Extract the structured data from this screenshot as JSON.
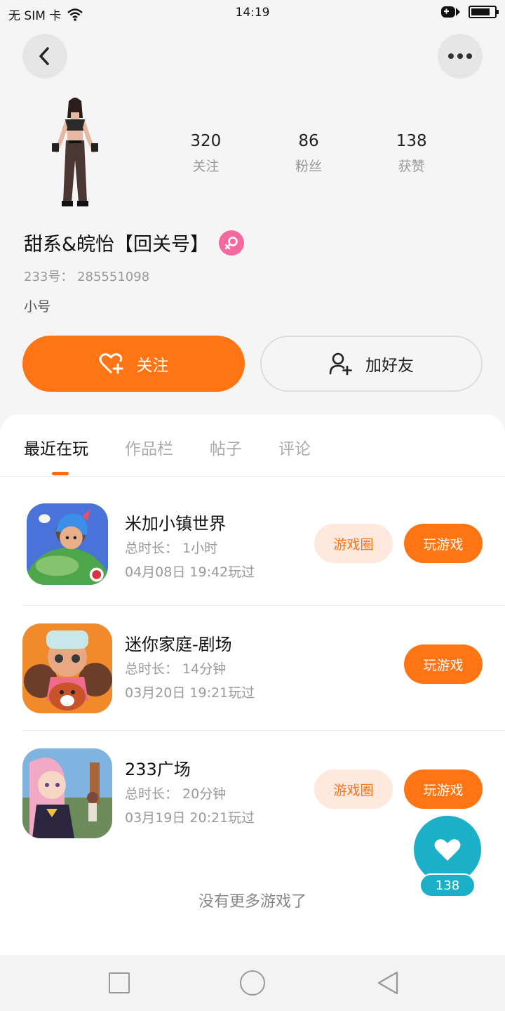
{
  "status_bar": {
    "carrier": "无 SIM 卡",
    "time": "14:19",
    "battery_level": 0.8
  },
  "profile": {
    "stats": [
      {
        "value": "320",
        "label": "关注"
      },
      {
        "value": "86",
        "label": "粉丝"
      },
      {
        "value": "138",
        "label": "获赞"
      }
    ],
    "username": "甜系&皖怡【回关号】",
    "uid": "233号： 285551098",
    "bio": "小号",
    "follow_label": "关注",
    "add_friend_label": "加好友"
  },
  "tabs": [
    {
      "label": "最近在玩",
      "active": true
    },
    {
      "label": "作品栏",
      "active": false
    },
    {
      "label": "帖子",
      "active": false
    },
    {
      "label": "评论",
      "active": false
    }
  ],
  "games": [
    {
      "title": "米加小镇世界",
      "duration": "总时长： 1小时",
      "last_played": "04月08日 19:42玩过",
      "circle_label": "游戏圈",
      "play_label": "玩游戏"
    },
    {
      "title": "迷你家庭-剧场",
      "duration": "总时长： 14分钟",
      "last_played": "03月20日 19:21玩过",
      "play_label": "玩游戏"
    },
    {
      "title": "233广场",
      "duration": "总时长： 20分钟",
      "last_played": "03月19日 20:21玩过",
      "circle_label": "游戏圈",
      "play_label": "玩游戏"
    }
  ],
  "no_more_text": "没有更多游戏了",
  "like_count": "138",
  "colors": {
    "accent": "#ff7413",
    "like": "#1bb0c7",
    "gender": "#f46a9e"
  }
}
